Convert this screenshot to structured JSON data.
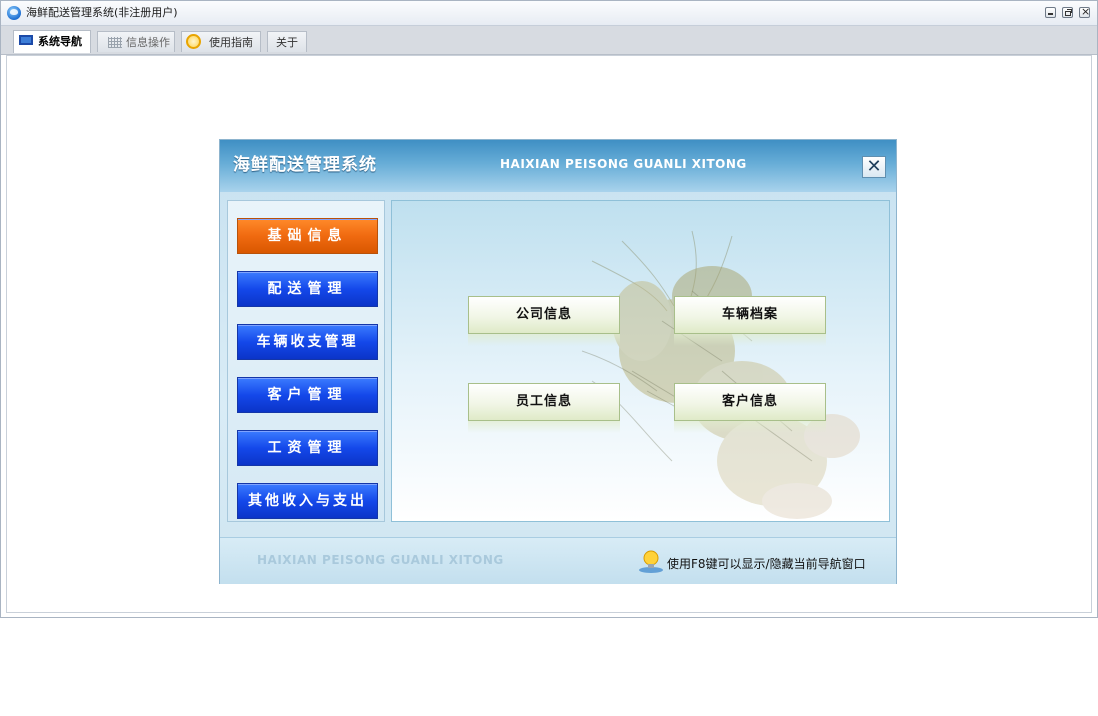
{
  "window": {
    "title": "海鲜配送管理系统(非注册用户)"
  },
  "tabs": [
    {
      "label": "系统导航",
      "icon": "monitor-icon",
      "active": true
    },
    {
      "label": "信息操作",
      "icon": "grid-icon",
      "active": false
    },
    {
      "label": "使用指南",
      "icon": "help-icon",
      "active": false
    },
    {
      "label": "关于",
      "icon": "",
      "active": false
    }
  ],
  "dialog": {
    "title": "海鲜配送管理系统",
    "subtitle": "HAIXIAN PEISONG GUANLI XITONG",
    "close_label": "✕",
    "menu": [
      {
        "label": "基础信息",
        "active": true
      },
      {
        "label": "配送管理",
        "active": false
      },
      {
        "label": "车辆收支管理",
        "active": false
      },
      {
        "label": "客户管理",
        "active": false
      },
      {
        "label": "工资管理",
        "active": false
      },
      {
        "label": "其他收入与支出",
        "active": false
      }
    ],
    "functions": [
      {
        "label": "公司信息"
      },
      {
        "label": "车辆档案"
      },
      {
        "label": "员工信息"
      },
      {
        "label": "客户信息"
      }
    ],
    "footer": {
      "brand": "HAIXIAN PEISONG GUANLI XITONG",
      "hint": "使用F8键可以显示/隐藏当前导航窗口"
    }
  },
  "colors": {
    "menu_active": "#f06a10",
    "menu_default": "#1448ea",
    "header_blue": "#3f8fc4"
  }
}
